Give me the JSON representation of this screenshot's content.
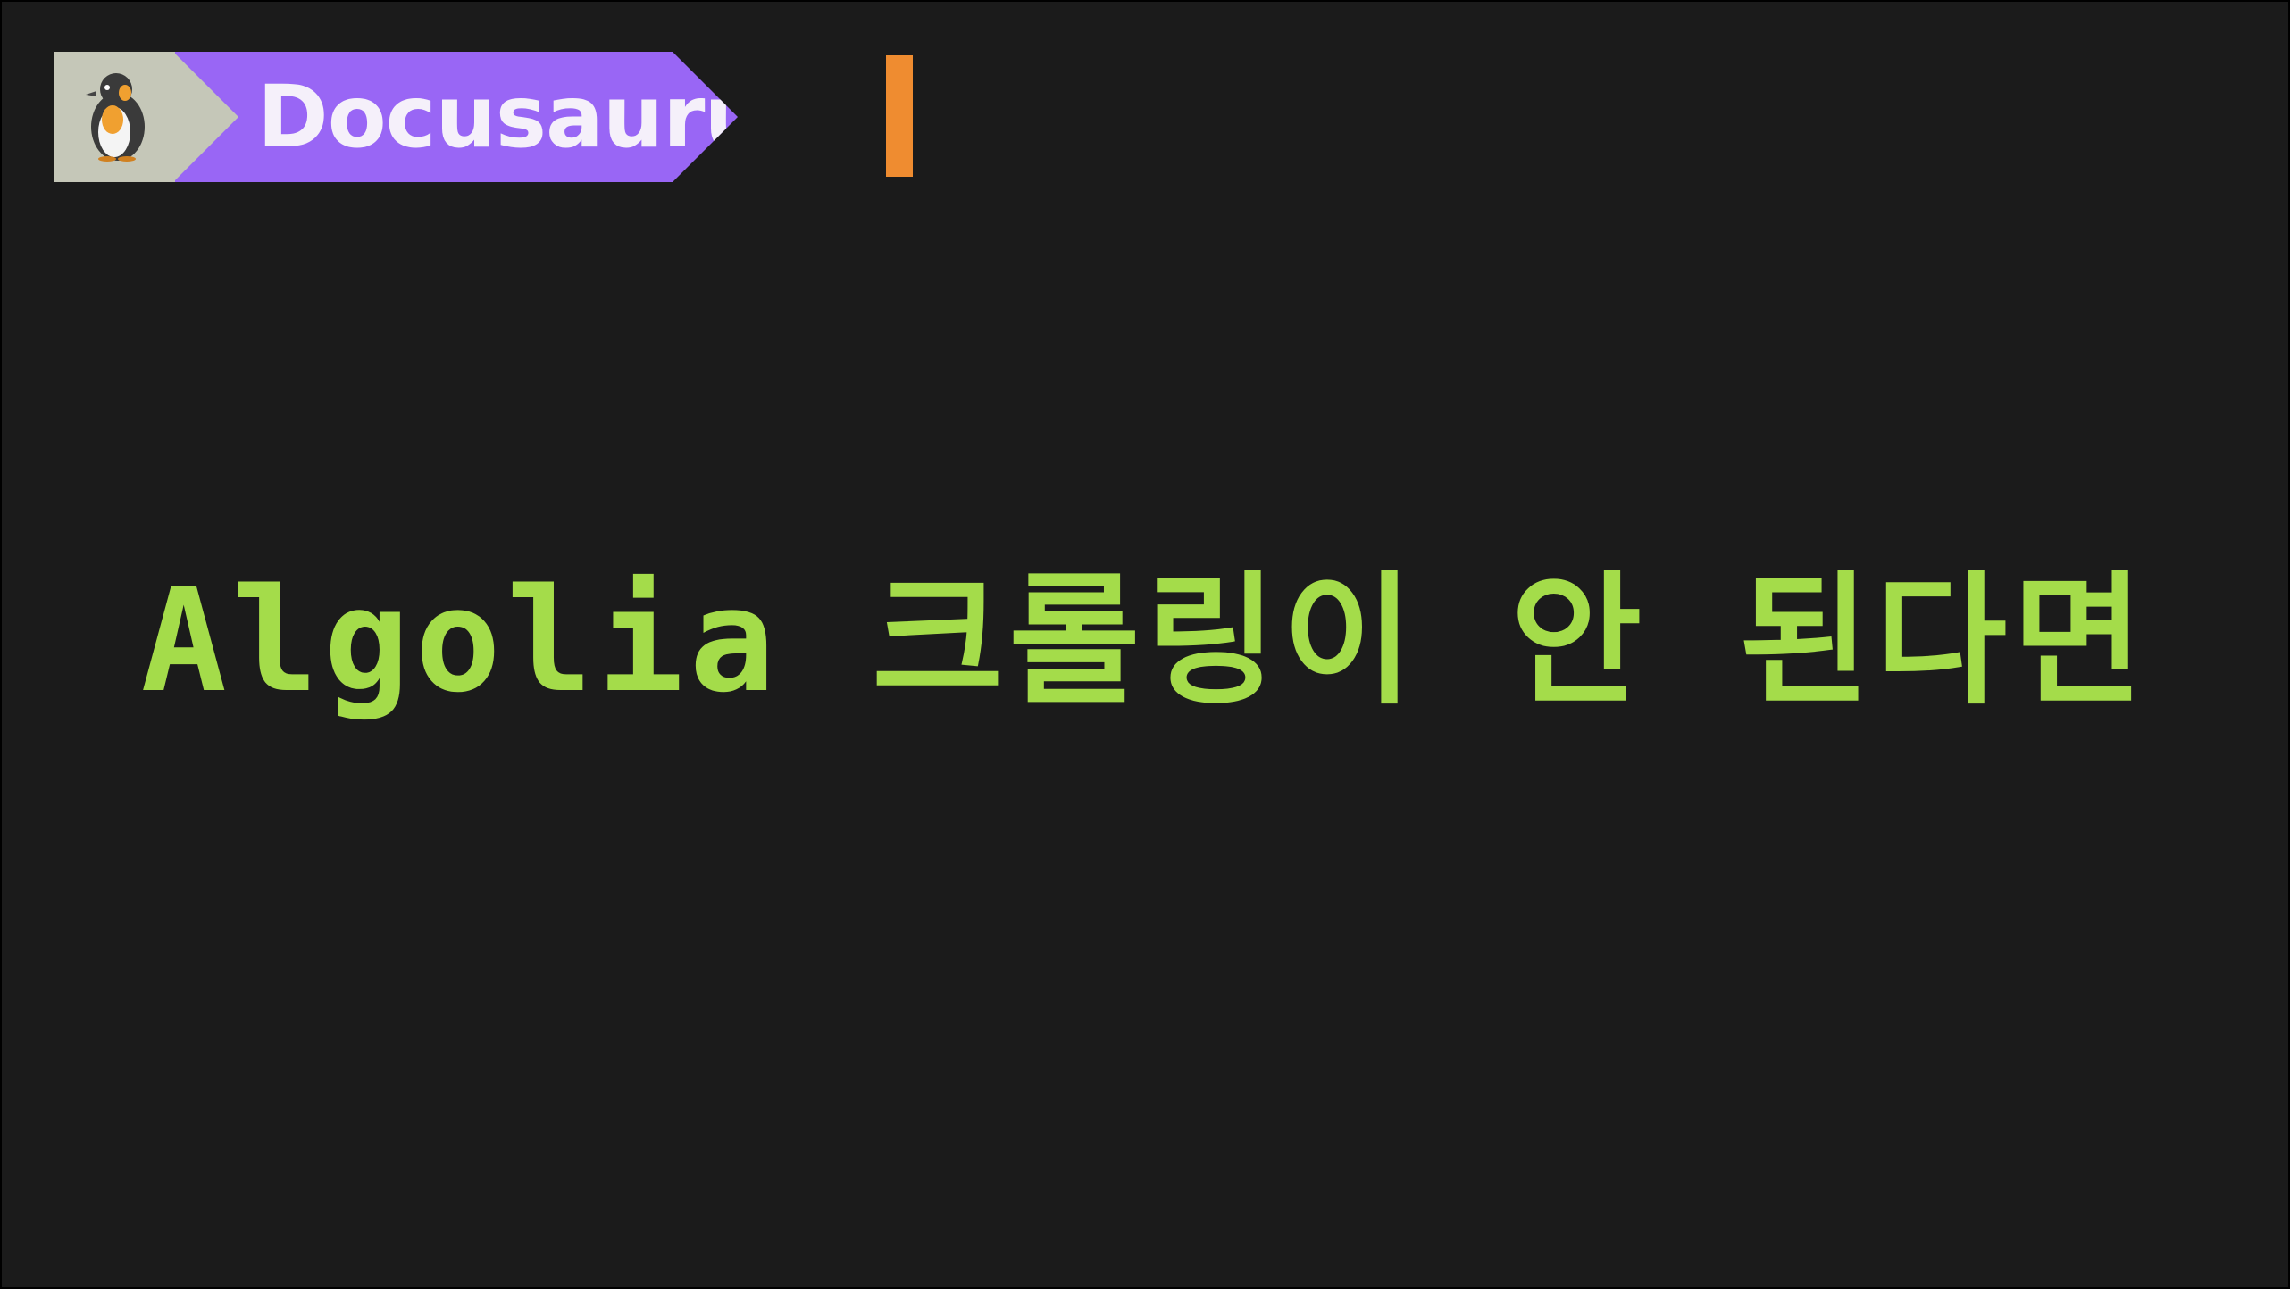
{
  "badge": {
    "icon": "penguin-icon",
    "label": "Docusaurus"
  },
  "headline": "Algolia 크롤링이 안 된다면",
  "colors": {
    "background": "#1b1b1b",
    "badge_label_bg": "#9966f5",
    "badge_icon_bg": "#c5c7b8",
    "cursor": "#ef8c30",
    "headline_text": "#a4dc4a"
  }
}
